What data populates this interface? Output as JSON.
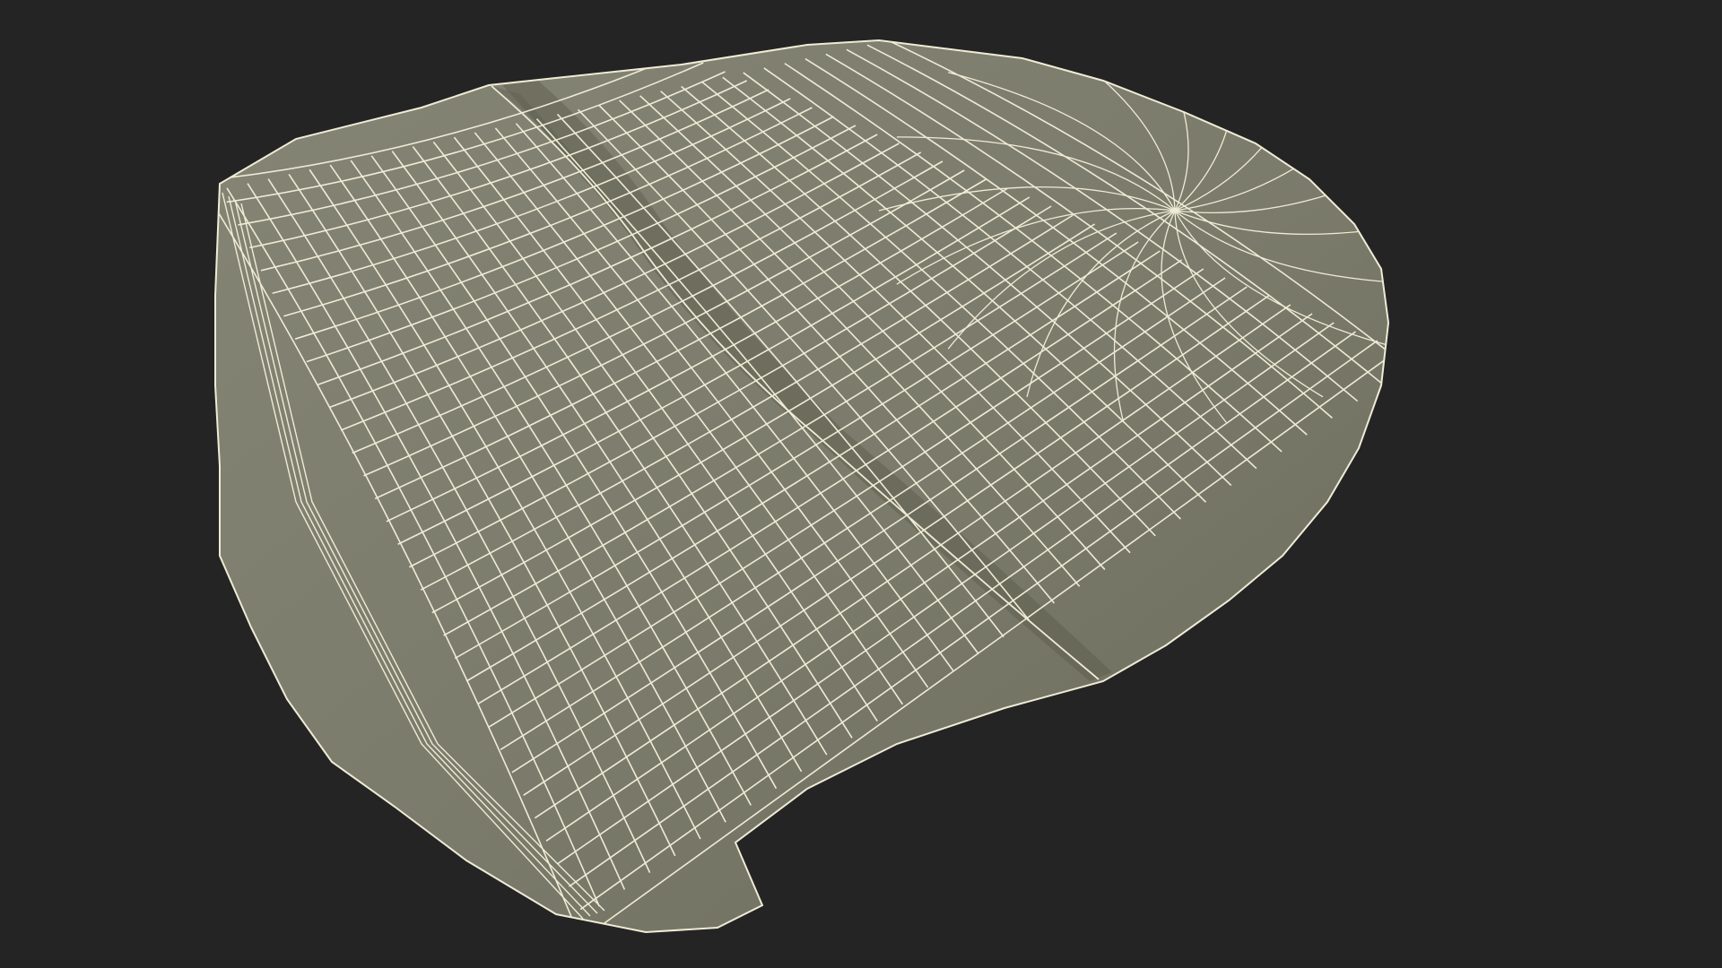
{
  "scene": {
    "subject": "beanie-hat-wireframe-mesh",
    "render_mode": "wireframe-over-shaded"
  },
  "colors": {
    "background": "#242424",
    "surface": "#7b7b6b",
    "surface_dark": "#6a6a5b",
    "surface_light": "#858575",
    "wire": "#efebd6",
    "crease_shadow": "#5a5a4c"
  }
}
